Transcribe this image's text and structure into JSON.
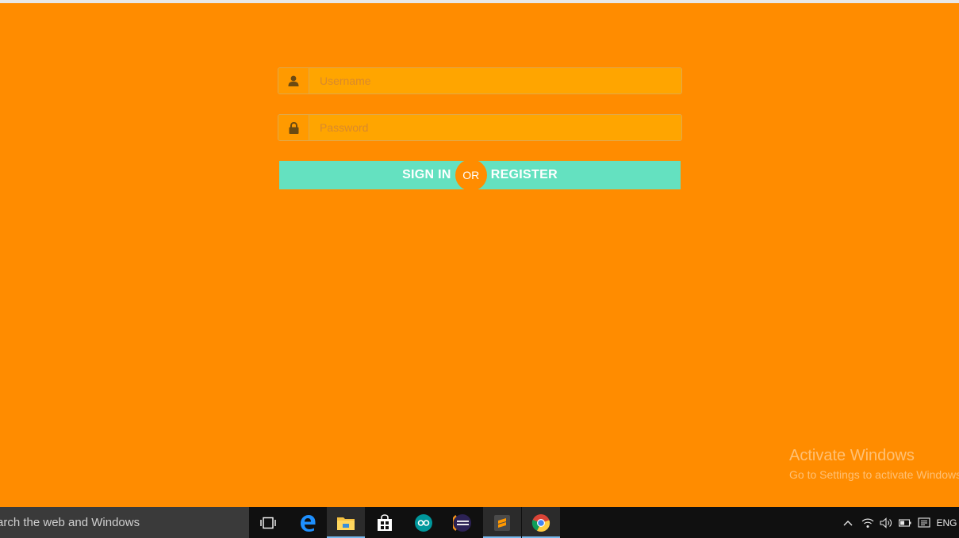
{
  "form": {
    "username_placeholder": "Username",
    "password_placeholder": "Password",
    "sign_in_label": "SIGN IN",
    "or_label": "OR",
    "register_label": "REGISTER"
  },
  "watermark": {
    "line1": "Activate Windows",
    "line2": "Go to Settings to activate Windows."
  },
  "taskbar": {
    "search_text": "arch the web and Windows",
    "icons": [
      "task-view-icon",
      "edge-icon",
      "file-explorer-icon",
      "store-icon",
      "arduino-icon",
      "eclipse-icon",
      "sublime-icon",
      "chrome-icon"
    ],
    "language": "ENG"
  },
  "colors": {
    "background": "#ff8c00",
    "input_background": "#ffa500",
    "button_background": "#64e1c0"
  }
}
